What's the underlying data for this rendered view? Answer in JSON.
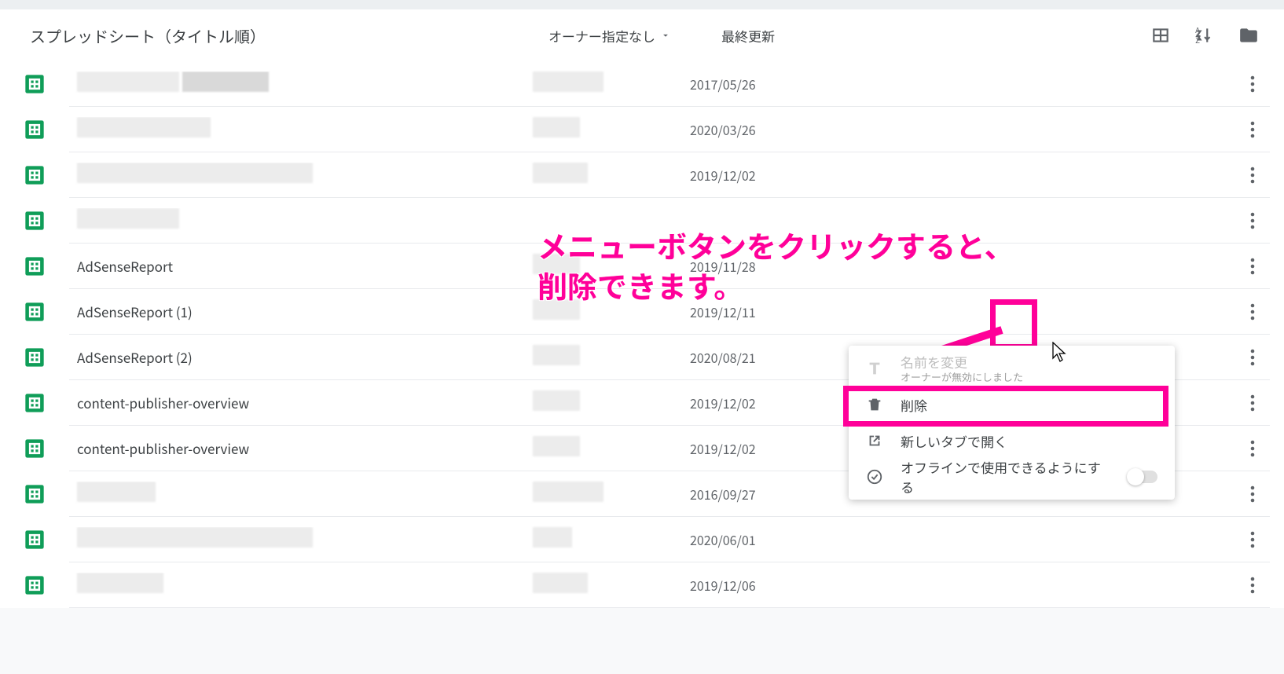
{
  "header": {
    "title": "スプレッドシート（タイトル順）",
    "owner_filter": "オーナー指定なし",
    "last_edit_header": "最終更新"
  },
  "rows": [
    {
      "name": "",
      "date": "2017/05/26",
      "redacted": true
    },
    {
      "name": "",
      "date": "2020/03/26",
      "redacted": true
    },
    {
      "name": "",
      "date": "2019/12/02",
      "redacted": true
    },
    {
      "name": "",
      "date": "",
      "redacted": true
    },
    {
      "name": "AdSenseReport",
      "date": "2019/11/28",
      "redacted": false
    },
    {
      "name": "AdSenseReport (1)",
      "date": "2019/12/11",
      "redacted": false,
      "highlight": true
    },
    {
      "name": "AdSenseReport (2)",
      "date": "2020/08/21",
      "redacted": false
    },
    {
      "name": "content-publisher-overview",
      "date": "2019/12/02",
      "redacted": false
    },
    {
      "name": "content-publisher-overview",
      "date": "2019/12/02",
      "redacted": false
    },
    {
      "name": "",
      "date": "2016/09/27",
      "redacted": true
    },
    {
      "name": "",
      "date": "2020/06/01",
      "redacted": true
    },
    {
      "name": "",
      "date": "2019/12/06",
      "redacted": true
    }
  ],
  "context_menu": {
    "rename_label": "名前を変更",
    "rename_sub": "オーナーが無効にしました",
    "delete_label": "削除",
    "newtab_label": "新しいタブで開く",
    "offline_label": "オフラインで使用できるようにする"
  },
  "annotation": {
    "line1": "メニューボタンをクリックすると、",
    "line2": "削除できます。"
  },
  "colors": {
    "accent": "#ff0099",
    "sheets_green": "#0f9d58"
  }
}
